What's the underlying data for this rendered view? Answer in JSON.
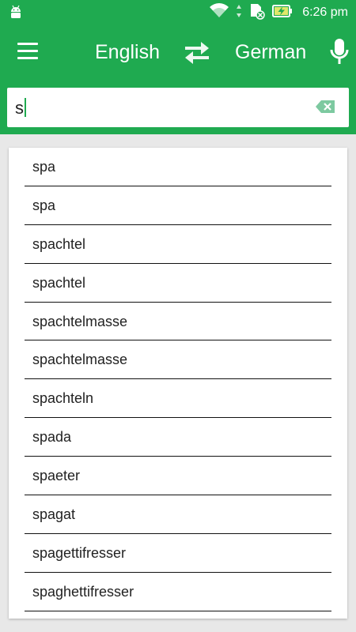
{
  "status": {
    "time": "6:26 pm"
  },
  "toolbar": {
    "source_language": "English",
    "target_language": "German",
    "menu_icon": "hamburger-menu-icon",
    "swap_icon": "swap-arrows-icon",
    "mic_icon": "microphone-icon"
  },
  "search": {
    "value": "s",
    "clear_icon": "backspace-clear-icon"
  },
  "suggestions": [
    "spa",
    "spa",
    "spachtel",
    "spachtel",
    "spachtelmasse",
    "spachtelmasse",
    "spachteln",
    "spada",
    "spaeter",
    "spagat",
    "spagettifresser",
    "spaghettifresser"
  ],
  "colors": {
    "primary": "#1faa50",
    "background": "#e8e8e8"
  }
}
